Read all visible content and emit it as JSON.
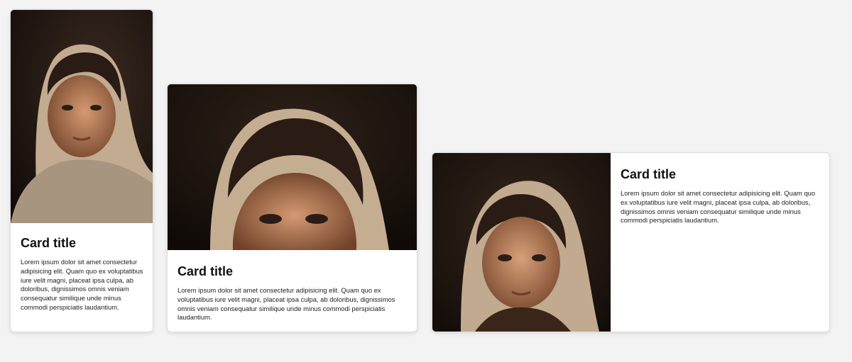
{
  "cards": [
    {
      "title": "Card title",
      "text": "Lorem ipsum dolor sit amet consectetur adipisicing elit. Quam quo ex voluptatibus iure velit magni, placeat ipsa culpa, ab doloribus, dignissimos omnis veniam consequatur similique unde minus commodi perspiciatis laudantium.",
      "image": "portrait-photo-girl-headscarf"
    },
    {
      "title": "Card title",
      "text": "Lorem ipsum dolor sit amet consectetur adipisicing elit. Quam quo ex voluptatibus iure velit magni, placeat ipsa culpa, ab doloribus, dignissimos omnis veniam consequatur similique unde minus commodi perspiciatis laudantium.",
      "image": "portrait-photo-girl-headscarf"
    },
    {
      "title": "Card title",
      "text": "Lorem ipsum dolor sit amet consectetur adipisicing elit. Quam quo ex voluptatibus iure velit magni, placeat ipsa culpa, ab doloribus, dignissimos omnis veniam consequatur similique unde minus commodi perspiciatis laudantium.",
      "image": "portrait-photo-girl-headscarf"
    }
  ],
  "colors": {
    "page_background": "#f3f3f4",
    "card_background": "#ffffff",
    "photo_background": "#1d140f",
    "headscarf": "#c9b49a",
    "skin": "#b07a58",
    "hair": "#2a1c14"
  }
}
